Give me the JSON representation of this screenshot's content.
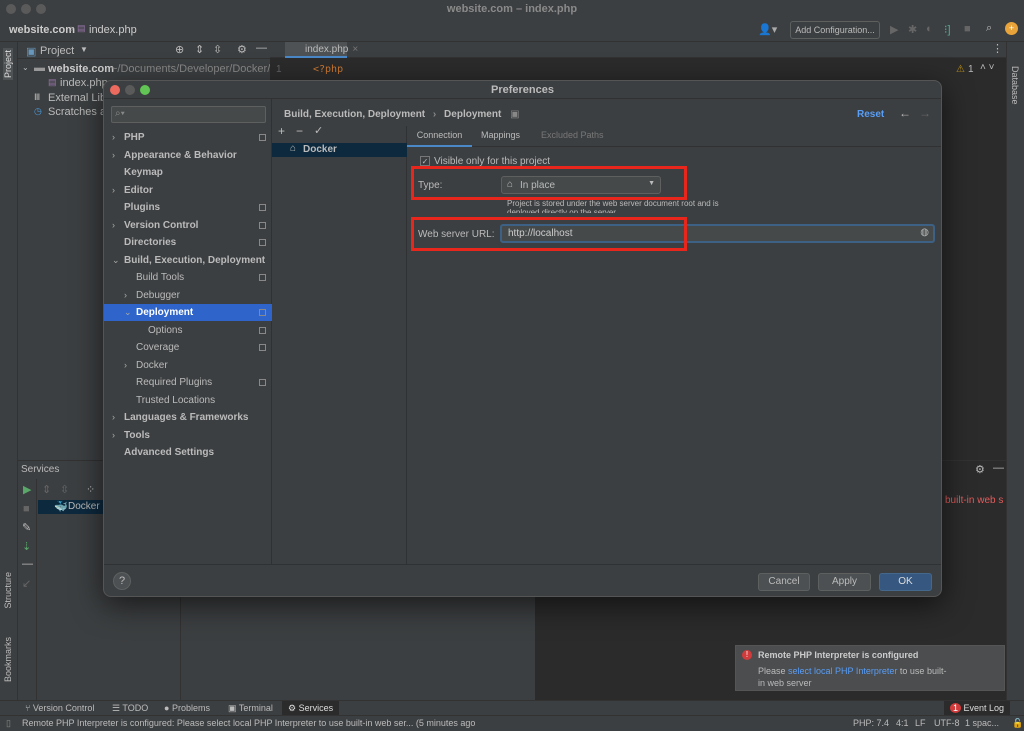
{
  "window": {
    "title": "website.com – index.php"
  },
  "nav": {
    "project": "website.com",
    "file": "index.php",
    "add_config": "Add Configuration..."
  },
  "project_panel": {
    "title": "Project",
    "root": "website.com",
    "root_path": "~/Documents/Developer/Docker/ww",
    "file": "index.php",
    "external": "External Libr",
    "scratches": "Scratches ar"
  },
  "editor": {
    "tab": "index.php",
    "line": "1",
    "code": "<?php",
    "warnings": "1"
  },
  "stripes": {
    "project": "Project",
    "database": "Database",
    "structure": "Structure",
    "bookmarks": "Bookmarks"
  },
  "services": {
    "title": "Services",
    "docker": "Docker",
    "error_snippet": "built-in web s"
  },
  "dialog": {
    "title": "Preferences",
    "breadcrumb_parent": "Build, Execution, Deployment",
    "breadcrumb_current": "Deployment",
    "reset": "Reset",
    "search_placeholder": "",
    "tree": [
      {
        "label": "PHP",
        "bold": true,
        "chev": true,
        "sq": true,
        "indent": 0
      },
      {
        "label": "Appearance & Behavior",
        "bold": true,
        "chev": true,
        "sq": false,
        "indent": 0
      },
      {
        "label": "Keymap",
        "bold": true,
        "chev": false,
        "sq": false,
        "indent": 0
      },
      {
        "label": "Editor",
        "bold": true,
        "chev": true,
        "sq": false,
        "indent": 0
      },
      {
        "label": "Plugins",
        "bold": true,
        "chev": false,
        "sq": true,
        "indent": 0
      },
      {
        "label": "Version Control",
        "bold": true,
        "chev": true,
        "sq": true,
        "indent": 0
      },
      {
        "label": "Directories",
        "bold": true,
        "chev": false,
        "sq": true,
        "indent": 0
      },
      {
        "label": "Build, Execution, Deployment",
        "bold": true,
        "chev": "open",
        "sq": false,
        "indent": 0
      },
      {
        "label": "Build Tools",
        "bold": false,
        "chev": false,
        "sq": true,
        "indent": 1
      },
      {
        "label": "Debugger",
        "bold": false,
        "chev": true,
        "sq": false,
        "indent": 1
      },
      {
        "label": "Deployment",
        "bold": true,
        "chev": "open",
        "sq": true,
        "indent": 1,
        "selected": true
      },
      {
        "label": "Options",
        "bold": false,
        "chev": false,
        "sq": true,
        "indent": 2
      },
      {
        "label": "Coverage",
        "bold": false,
        "chev": false,
        "sq": true,
        "indent": 1
      },
      {
        "label": "Docker",
        "bold": false,
        "chev": true,
        "sq": false,
        "indent": 1
      },
      {
        "label": "Required Plugins",
        "bold": false,
        "chev": false,
        "sq": true,
        "indent": 1
      },
      {
        "label": "Trusted Locations",
        "bold": false,
        "chev": false,
        "sq": false,
        "indent": 1
      },
      {
        "label": "Languages & Frameworks",
        "bold": true,
        "chev": true,
        "sq": false,
        "indent": 0
      },
      {
        "label": "Tools",
        "bold": true,
        "chev": true,
        "sq": false,
        "indent": 0
      },
      {
        "label": "Advanced Settings",
        "bold": true,
        "chev": false,
        "sq": false,
        "indent": 0
      }
    ],
    "server": "Docker",
    "tabs": [
      "Connection",
      "Mappings",
      "Excluded Paths"
    ],
    "visible_only": "Visible only for this project",
    "visible_checked": true,
    "type_label": "Type:",
    "type_value": "In place",
    "type_hint": "Project is stored under the web server document root and is deployed directly on the server",
    "url_label": "Web server URL:",
    "url_value": "http://localhost",
    "help": "?",
    "cancel": "Cancel",
    "apply": "Apply",
    "ok": "OK"
  },
  "notification": {
    "title": "Remote PHP Interpreter is configured",
    "pre": "Please ",
    "link": "select local PHP Interpreter",
    "post": " to use built-in web server"
  },
  "toolwindows": [
    "Version Control",
    "TODO",
    "Problems",
    "Terminal",
    "Services"
  ],
  "event_log": "Event Log",
  "event_count": "1",
  "status": {
    "message": "Remote PHP Interpreter is configured: Please select local PHP Interpreter to use built-in web ser... (5 minutes ago",
    "php": "PHP: 7.4",
    "pos": "4:1",
    "lf": "LF",
    "enc": "UTF-8",
    "indent": "1 spac..."
  },
  "colors": {
    "accent": "#2f65ca",
    "link": "#589df6",
    "highlight": "#e8261c",
    "ok": "#365880"
  }
}
